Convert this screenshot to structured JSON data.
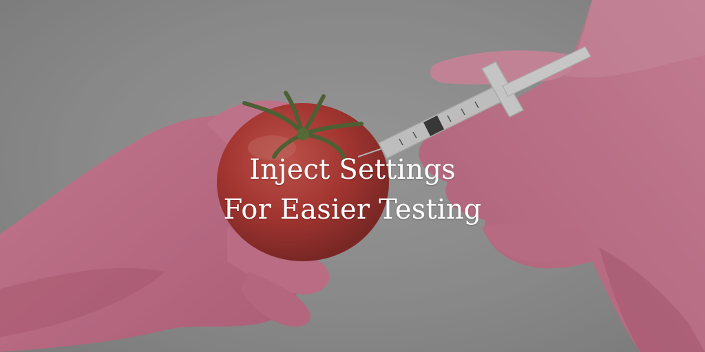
{
  "headline": {
    "line1": "Inject Settings",
    "line2": "For Easier Testing"
  },
  "colors": {
    "glove": "#e8799a",
    "glove_shadow": "#c95c7d",
    "tomato": "#c8302a",
    "stem": "#4f6b2e",
    "background": "#a8a8a8",
    "text": "#ffffff"
  },
  "icons": {
    "syringe": "syringe-icon",
    "tomato": "tomato-icon"
  }
}
